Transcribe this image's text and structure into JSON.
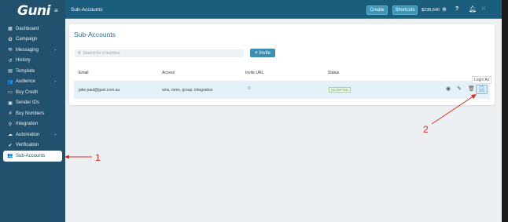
{
  "brand": {
    "logo": "Guni"
  },
  "sidebar": {
    "items": [
      {
        "label": "Dashboard",
        "icon": "grid-icon",
        "glyph": "▦"
      },
      {
        "label": "Campaign",
        "icon": "campaign-icon",
        "glyph": "✪"
      },
      {
        "label": "Messaging",
        "icon": "message-icon",
        "glyph": "✉",
        "chev": "›"
      },
      {
        "label": "History",
        "icon": "history-icon",
        "glyph": "↺"
      },
      {
        "label": "Template",
        "icon": "template-icon",
        "glyph": "▤"
      },
      {
        "label": "Audience",
        "icon": "audience-icon",
        "glyph": "👥",
        "chev": "›"
      },
      {
        "label": "Buy Credit",
        "icon": "credit-card-icon",
        "glyph": "▭"
      },
      {
        "label": "Sender IDs",
        "icon": "sender-id-icon",
        "glyph": "▣"
      },
      {
        "label": "Buy Numbers",
        "icon": "hash-icon",
        "glyph": "#"
      },
      {
        "label": "Integration",
        "icon": "plug-icon",
        "glyph": "⚲"
      },
      {
        "label": "Automation",
        "icon": "cloud-icon",
        "glyph": "☁",
        "chev": "›"
      },
      {
        "label": "Verification",
        "icon": "check-circle-icon",
        "glyph": "✔"
      },
      {
        "label": "Sub-Accounts",
        "icon": "sub-accounts-icon",
        "glyph": "👥"
      }
    ]
  },
  "topbar": {
    "title": "Sub-Accounts",
    "create_label": "Create",
    "shortcuts_label": "Shortcuts",
    "balance": "$238,640",
    "help": "?"
  },
  "main": {
    "title": "Sub-Accounts",
    "search_placeholder": "Search for a member",
    "invite_label": "Invite",
    "columns": [
      "Email",
      "Access",
      "Invite URL",
      "Status"
    ],
    "rows": [
      {
        "email": "jake.paul@guni.com.au",
        "access": "sms, mms, group, integration",
        "status": "ACCEPTED"
      }
    ],
    "tooltip": "Login As"
  },
  "annotations": {
    "one": "1",
    "two": "2"
  },
  "colors": {
    "sidebar": "#21516c",
    "topbar": "#1b5d7c",
    "accent": "#3b8fb2",
    "annotation": "#d93025"
  }
}
